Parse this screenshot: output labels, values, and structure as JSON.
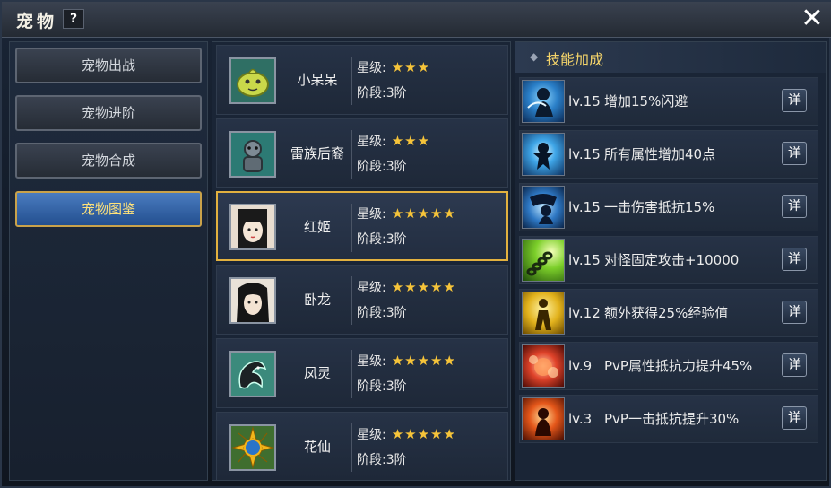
{
  "window": {
    "title": "宠物",
    "help_label": "?",
    "close_label": "✕"
  },
  "menu": {
    "items": [
      {
        "label": "宠物出战",
        "active": false
      },
      {
        "label": "宠物进阶",
        "active": false
      },
      {
        "label": "宠物合成",
        "active": false
      },
      {
        "label": "宠物图鉴",
        "active": true
      }
    ]
  },
  "pets": [
    {
      "name": "小呆呆",
      "star_label": "星级:",
      "stars": "★★★",
      "star_count": 3,
      "stage_label": "阶段:",
      "stage": "3阶",
      "selected": false
    },
    {
      "name": "雷族后裔",
      "star_label": "星级:",
      "stars": "★★★",
      "star_count": 3,
      "stage_label": "阶段:",
      "stage": "3阶",
      "selected": false
    },
    {
      "name": "红姬",
      "star_label": "星级:",
      "stars": "★★★★★",
      "star_count": 5,
      "stage_label": "阶段:",
      "stage": "3阶",
      "selected": true
    },
    {
      "name": "卧龙",
      "star_label": "星级:",
      "stars": "★★★★★",
      "star_count": 5,
      "stage_label": "阶段:",
      "stage": "3阶",
      "selected": false
    },
    {
      "name": "凤灵",
      "star_label": "星级:",
      "stars": "★★★★★",
      "star_count": 5,
      "stage_label": "阶段:",
      "stage": "3阶",
      "selected": false
    },
    {
      "name": "花仙",
      "star_label": "星级:",
      "stars": "★★★★★",
      "star_count": 5,
      "stage_label": "阶段:",
      "stage": "3阶",
      "selected": false
    }
  ],
  "skills": {
    "header": "技能加成",
    "items": [
      {
        "level": "lv.15",
        "desc": "增加15%闪避",
        "button": "详",
        "icon": "dodge-icon"
      },
      {
        "level": "lv.15",
        "desc": "所有属性增加40点",
        "button": "详",
        "icon": "all-attributes-icon"
      },
      {
        "level": "lv.15",
        "desc": "一击伤害抵抗15%",
        "button": "详",
        "icon": "damage-resist-icon"
      },
      {
        "level": "lv.15",
        "desc": "对怪固定攻击+10000",
        "button": "详",
        "icon": "monster-attack-icon"
      },
      {
        "level": "lv.12",
        "desc": "额外获得25%经验值",
        "button": "详",
        "icon": "experience-icon"
      },
      {
        "level": "lv.9",
        "desc": "PvP属性抵抗力提升45%",
        "button": "详",
        "icon": "pvp-resist-icon"
      },
      {
        "level": "lv.3",
        "desc": "PvP一击抵抗提升30%",
        "button": "详",
        "icon": "pvp-strike-icon"
      }
    ]
  },
  "colors": {
    "accent_gold": "#e2b13f",
    "star": "#f6c43a",
    "header_text": "#f3d36a",
    "active_menu": "#234f8f"
  }
}
